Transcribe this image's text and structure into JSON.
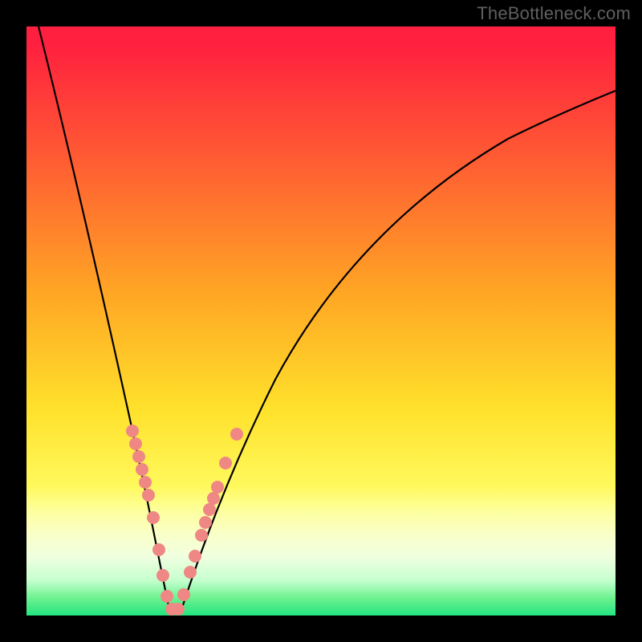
{
  "watermark": {
    "text": "TheBottleneck.com"
  },
  "chart_data": {
    "type": "line",
    "title": "",
    "xlabel": "",
    "ylabel": "",
    "xlim": [
      0,
      100
    ],
    "ylim": [
      0,
      100
    ],
    "grid": false,
    "curve_description": "V-shaped bottleneck curve: starts near 100% at x≈0, dips to 0% near x≈24, rises back toward ~80% at x≈100",
    "series": [
      {
        "name": "bottleneck-curve",
        "x": [
          0,
          4,
          8,
          12,
          16,
          18,
          20,
          22,
          24,
          26,
          28,
          32,
          40,
          50,
          60,
          70,
          80,
          90,
          100
        ],
        "y": [
          100,
          86,
          72,
          56,
          36,
          25,
          15,
          6,
          0,
          4,
          10,
          24,
          43,
          57,
          65,
          71,
          76,
          79,
          80
        ]
      }
    ],
    "markers": [
      {
        "name": "highlight-dots",
        "color": "#f08080",
        "description": "Salmon dot segments overlaid along the lower portion of the V",
        "points": [
          {
            "x": 17,
            "y": 31
          },
          {
            "x": 17.6,
            "y": 28.5
          },
          {
            "x": 18.2,
            "y": 26
          },
          {
            "x": 18.8,
            "y": 23.5
          },
          {
            "x": 19.4,
            "y": 21
          },
          {
            "x": 20.2,
            "y": 17
          },
          {
            "x": 21.5,
            "y": 11
          },
          {
            "x": 22.5,
            "y": 6
          },
          {
            "x": 23.4,
            "y": 2
          },
          {
            "x": 24.7,
            "y": 1
          },
          {
            "x": 25.3,
            "y": 2.4
          },
          {
            "x": 26.8,
            "y": 6
          },
          {
            "x": 27.4,
            "y": 8
          },
          {
            "x": 28.6,
            "y": 12
          },
          {
            "x": 29.2,
            "y": 14
          },
          {
            "x": 29.8,
            "y": 16
          },
          {
            "x": 30.4,
            "y": 18
          },
          {
            "x": 31,
            "y": 20
          },
          {
            "x": 32.5,
            "y": 25
          },
          {
            "x": 34.5,
            "y": 30
          }
        ]
      }
    ],
    "background_gradient": {
      "direction": "vertical",
      "stops": [
        {
          "pos": 0.0,
          "color": "#ff203f"
        },
        {
          "pos": 0.45,
          "color": "#ffa524"
        },
        {
          "pos": 0.78,
          "color": "#fff95c"
        },
        {
          "pos": 1.0,
          "color": "#22e580"
        }
      ]
    }
  }
}
